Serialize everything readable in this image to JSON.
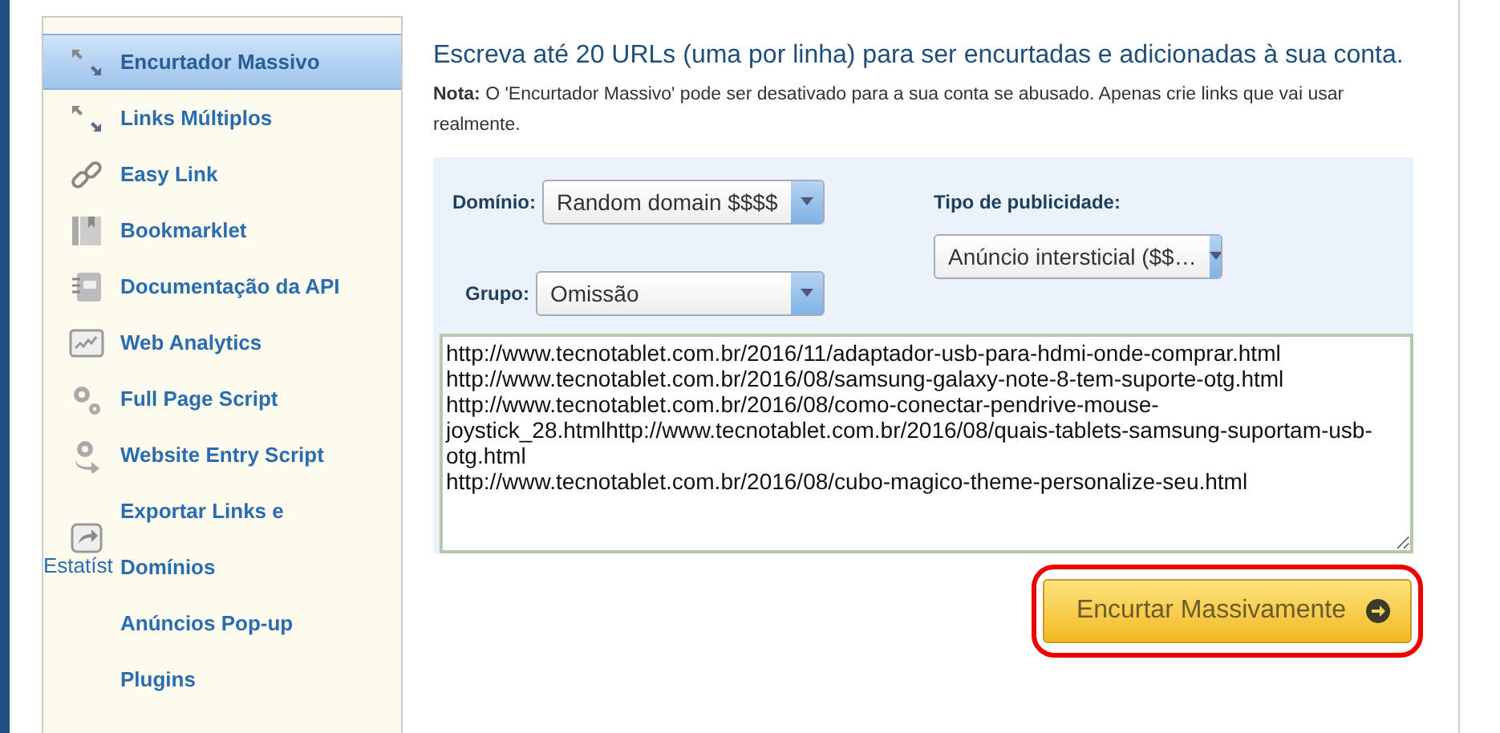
{
  "sidebar": {
    "items": [
      {
        "label": "Encurtador Massivo",
        "selected": true
      },
      {
        "label": "Links Múltiplos",
        "selected": false
      },
      {
        "label": "Easy Link",
        "selected": false
      },
      {
        "label": "Bookmarklet",
        "selected": false
      },
      {
        "label": "Documentação da API",
        "selected": false
      },
      {
        "label": "Web Analytics",
        "selected": false
      },
      {
        "label": "Full Page Script",
        "selected": false
      },
      {
        "label": "Website Entry Script",
        "selected": false
      },
      {
        "label": "Exportar Links e Domínios",
        "selected": false,
        "caption": "Estatíst"
      },
      {
        "label": "Anúncios Pop-up",
        "selected": false
      },
      {
        "label": "Plugins",
        "selected": false
      }
    ]
  },
  "main": {
    "heading": "Escreva até 20 URLs (uma por linha) para ser encurtadas e adicionadas à sua conta.",
    "note": "**Nota:** O 'Encurtador Massivo' pode ser desativado para a sua conta se abusado. Apenas crie links que vai usar realmente.",
    "fields": [
      {
        "label": "Domínio:",
        "value": "Random domain $$$$"
      },
      {
        "label": "Tipo de publicidade:",
        "value": "Anúncio intersticial ($$…"
      },
      {
        "label": "Grupo:",
        "value": "Omissão"
      }
    ],
    "urls": [
      "http://www.tecnotablet.com.br/2016/11/adaptador-usb-para-hdmi-onde-comprar.html",
      "http://www.tecnotablet.com.br/2016/08/samsung-galaxy-note-8-tem-suporte-otg.html",
      "http://www.tecnotablet.com.br/2016/08/como-conectar-pendrive-mouse-joystick_28.htmlhttp://www.tecnotablet.com.br/2016/08/quais-tablets-samsung-suportam-usb-otg.html",
      "http://www.tecnotablet.com.br/2016/08/cubo-magico-theme-personalize-seu.html"
    ],
    "submit": {
      "label": "Encurtar Massivamente",
      "highlighted": true
    }
  }
}
